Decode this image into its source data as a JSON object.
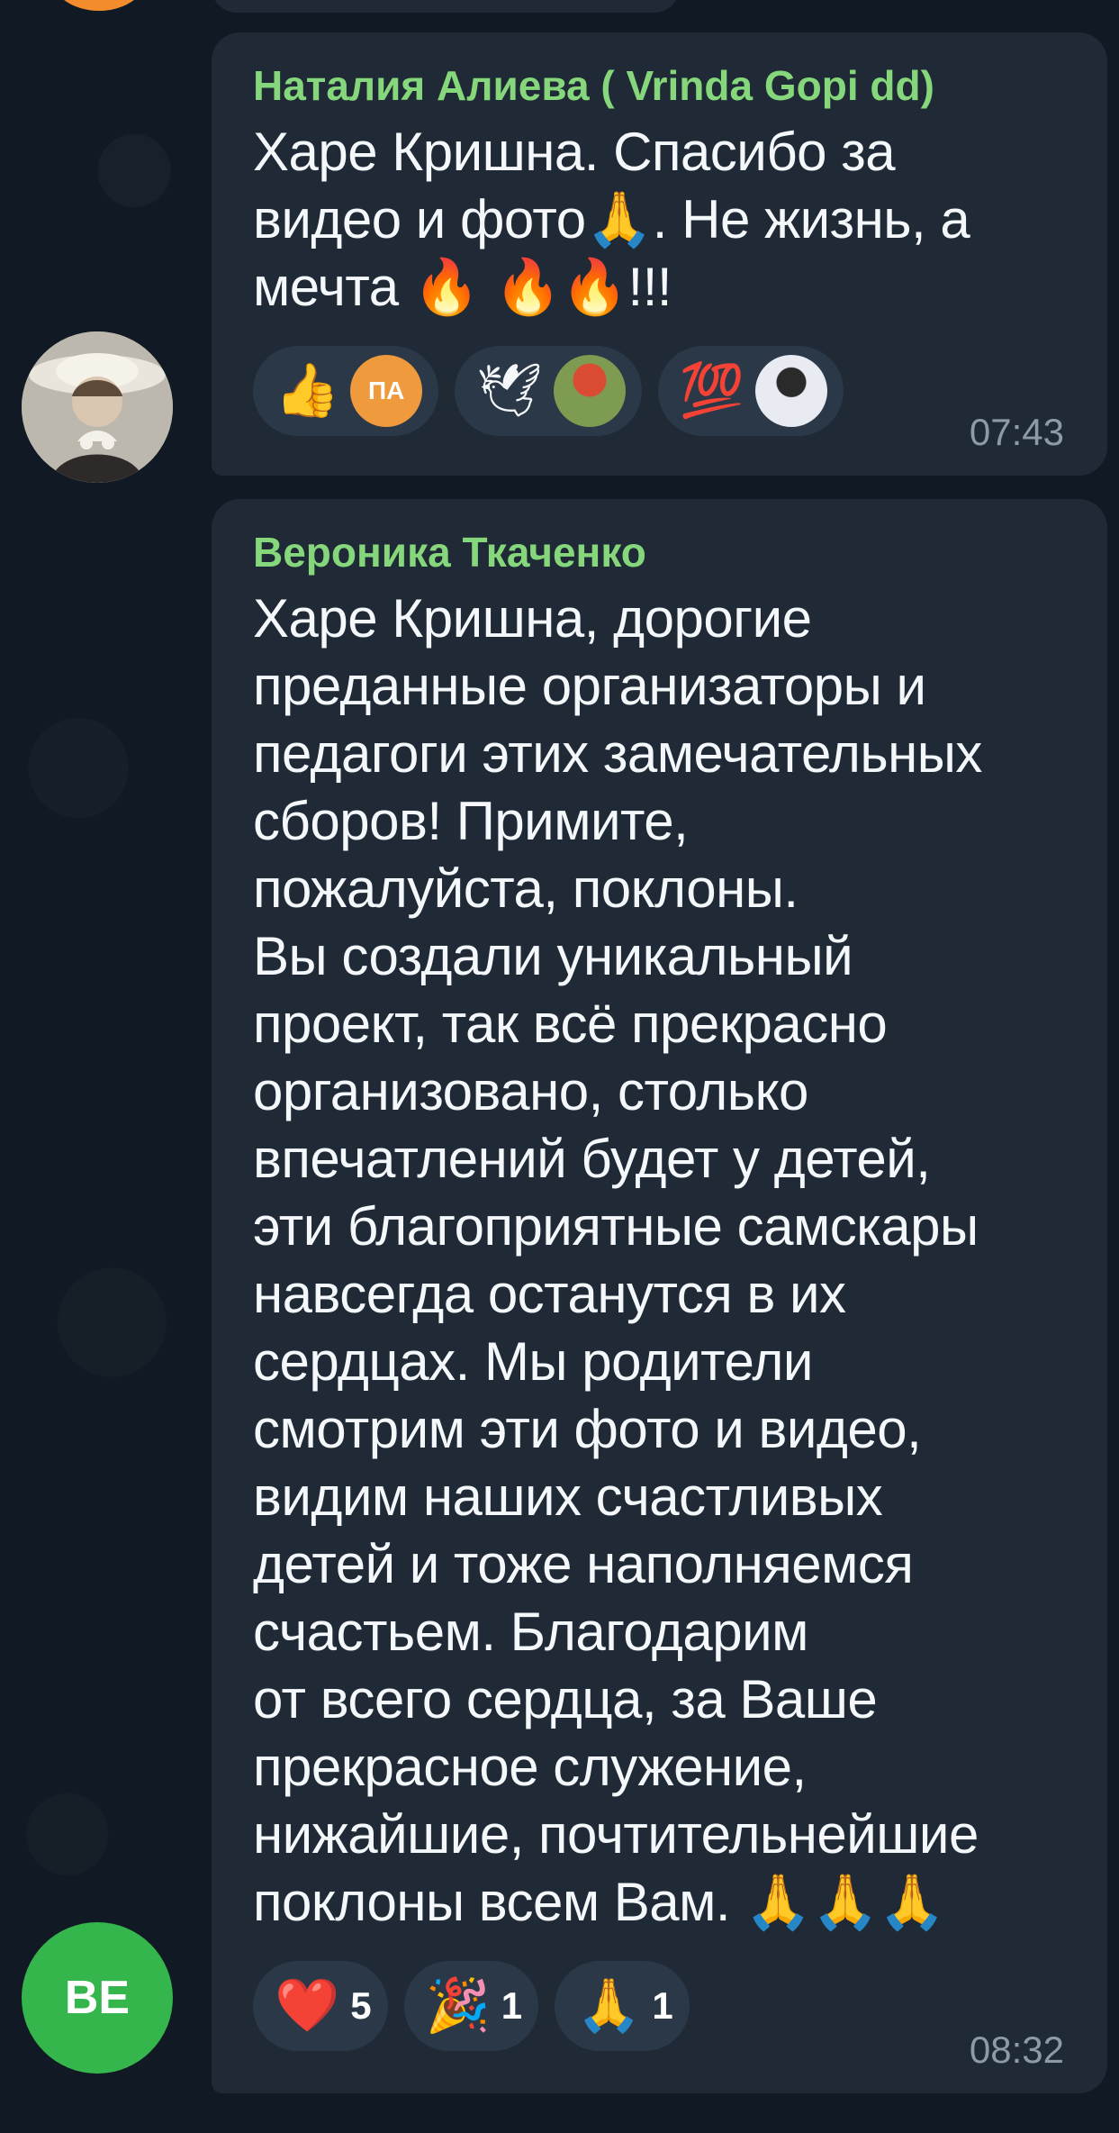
{
  "chat": {
    "messages": [
      {
        "sender": "Наталия Алиева ( Vrinda Gopi dd)",
        "text": "Харе Кришна. Спасибо за\nвидео и фото🙏. Не жизнь, а\nмечта  🔥 🔥🔥!!!",
        "time": "07:43",
        "reactions": [
          {
            "emoji": "👍",
            "avatar_initials": "ПА"
          },
          {
            "emoji": "🕊"
          },
          {
            "emoji": "💯"
          }
        ]
      },
      {
        "sender": "Вероника Ткаченко",
        "avatar_initials": "BE",
        "text": "Харе Кришна, дорогие\nпреданные организаторы и\nпедагоги этих замечательных\nсборов! Примите,\nпожалуйста, поклоны.\nВы создали уникальный\nпроект, так всё прекрасно\nорганизовано, столько\nвпечатлений будет у детей,\nэти благоприятные самскары\nнавсегда останутся в их\nсердцах. Мы родители\nсмотрим эти фото и видео,\nвидим наших счастливых\nдетей и тоже наполняемся\nсчастьем. Благодарим\nот всего сердца, за Ваше\nпрекрасное служение,\nнижайшие, почтительнейшие\nпоклоны всем Вам. 🙏🙏🙏",
        "time": "08:32",
        "reactions": [
          {
            "emoji": "❤️",
            "count": "5"
          },
          {
            "emoji": "🎉",
            "count": "1"
          },
          {
            "emoji": "🙏",
            "count": "1"
          }
        ]
      }
    ]
  },
  "colors": {
    "background": "#111a24",
    "bubble": "#1f2a36",
    "reaction_pill": "#2b3847",
    "sender_name": "#86d77b",
    "timestamp": "#8d9aa8",
    "avatar_green": "#35b64c",
    "avatar_orange": "#ef9a3d"
  },
  "icons": {
    "photo_avatar": "user-photo-avatar",
    "reaction_avatar_flowers": "flowers-avatar",
    "reaction_avatar_woman": "woman-avatar"
  }
}
